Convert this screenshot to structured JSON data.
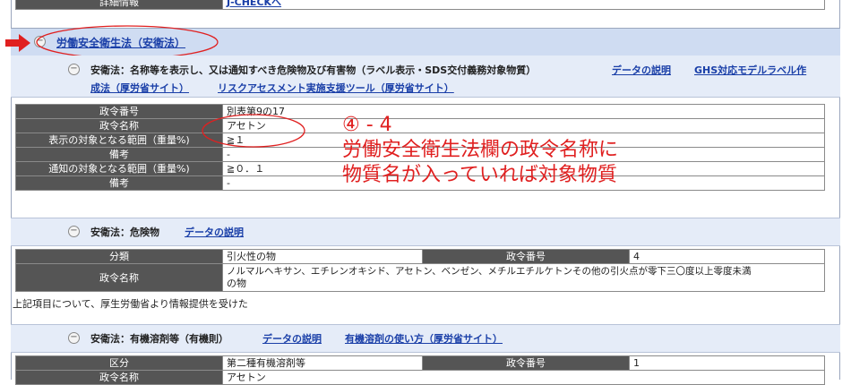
{
  "top_row": {
    "label": "詳細情報",
    "link": "J-CHECKへ"
  },
  "section_main": {
    "title": "労働安全衛生法（安衛法）"
  },
  "section1": {
    "title": "安衛法：名称等を表示し、又は通知すべき危険物及び有害物（ラベル表示・SDS交付義務対象物質）",
    "link_data": "データの説明",
    "link_ghs_line1": "GHS対応モデルラベル作",
    "link_ghs_line2": "成法（厚労省サイト）",
    "link_risk": "リスクアセスメント実施支援ツール（厚労省サイト）",
    "rows": [
      {
        "label": "政令番号",
        "value": "別表第9の17"
      },
      {
        "label": "政令名称",
        "value": "アセトン"
      },
      {
        "label": "表示の対象となる範囲（重量%)",
        "value": "≧１"
      },
      {
        "label": "備考",
        "value": "-"
      },
      {
        "label": "通知の対象となる範囲（重量%)",
        "value": "≧０．１"
      },
      {
        "label": "備考",
        "value": "-"
      }
    ]
  },
  "annotation": {
    "line1": "④ - 4",
    "line2": "労働安全衛生法欄の政令名称に",
    "line3": "物質名が入っていれば対象物質",
    "color": "#e02020"
  },
  "section2": {
    "title": "安衛法：危険物",
    "link_data": "データの説明",
    "row1": {
      "label_a": "分類",
      "value_a": "引火性の物",
      "label_b": "政令番号",
      "value_b": "4"
    },
    "row2": {
      "label": "政令名称",
      "value_line1": "ノルマルヘキサン、エチレンオキシド、アセトン、ベンゼン、メチルエチルケトンその他の引火点が零下三〇度以上零度未満",
      "value_line2": "の物"
    }
  },
  "note": "上記項目について、厚生労働省より情報提供を受けた",
  "section3": {
    "title": "安衛法：有機溶剤等（有機則）",
    "link_data": "データの説明",
    "link_usage": "有機溶剤の使い方（厚労省サイト）",
    "row1": {
      "label_a": "区分",
      "value_a": "第二種有機溶剤等",
      "label_b": "政令番号",
      "value_b": "1"
    },
    "row2": {
      "label": "政令名称",
      "value": "アセトン"
    }
  },
  "colors": {
    "header_bg": "#cfdcf2",
    "subheader_bg": "#e5ecf8",
    "label_bg": "#555555",
    "link": "#1a3fa8",
    "arrow": "#e02020"
  }
}
